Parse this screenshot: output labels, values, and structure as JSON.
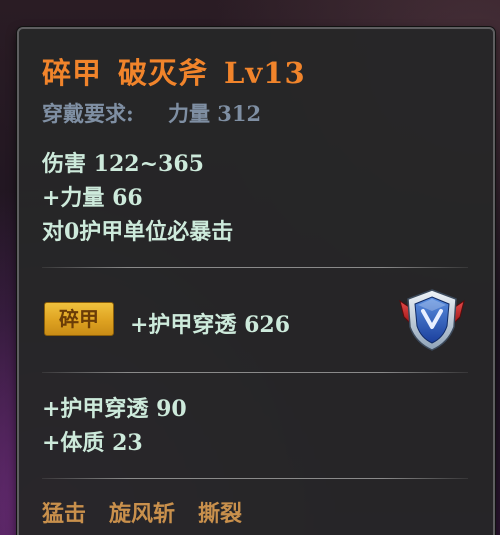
{
  "item": {
    "title_part1": "碎甲",
    "title_part2": "破灭斧",
    "title_level": "Lv13"
  },
  "requirement": {
    "label": "穿戴要求:",
    "value": "力量 312"
  },
  "base_stats": [
    "伤害  122~365",
    "+力量  66",
    "对0护甲单位必暴击"
  ],
  "enchant": {
    "badge": "碎甲",
    "text": "+护甲穿透  626",
    "icon": "shield-emblem-icon"
  },
  "extra_stats": [
    "+护甲穿透  90",
    "+体质  23"
  ],
  "skills": [
    "猛击",
    "旋风斩",
    "撕裂"
  ],
  "colors": {
    "title": "#f1842b",
    "requirement": "#7f8fa3",
    "stat": "#cdeadb",
    "skill": "#c9904c",
    "badge": "#dea221"
  }
}
